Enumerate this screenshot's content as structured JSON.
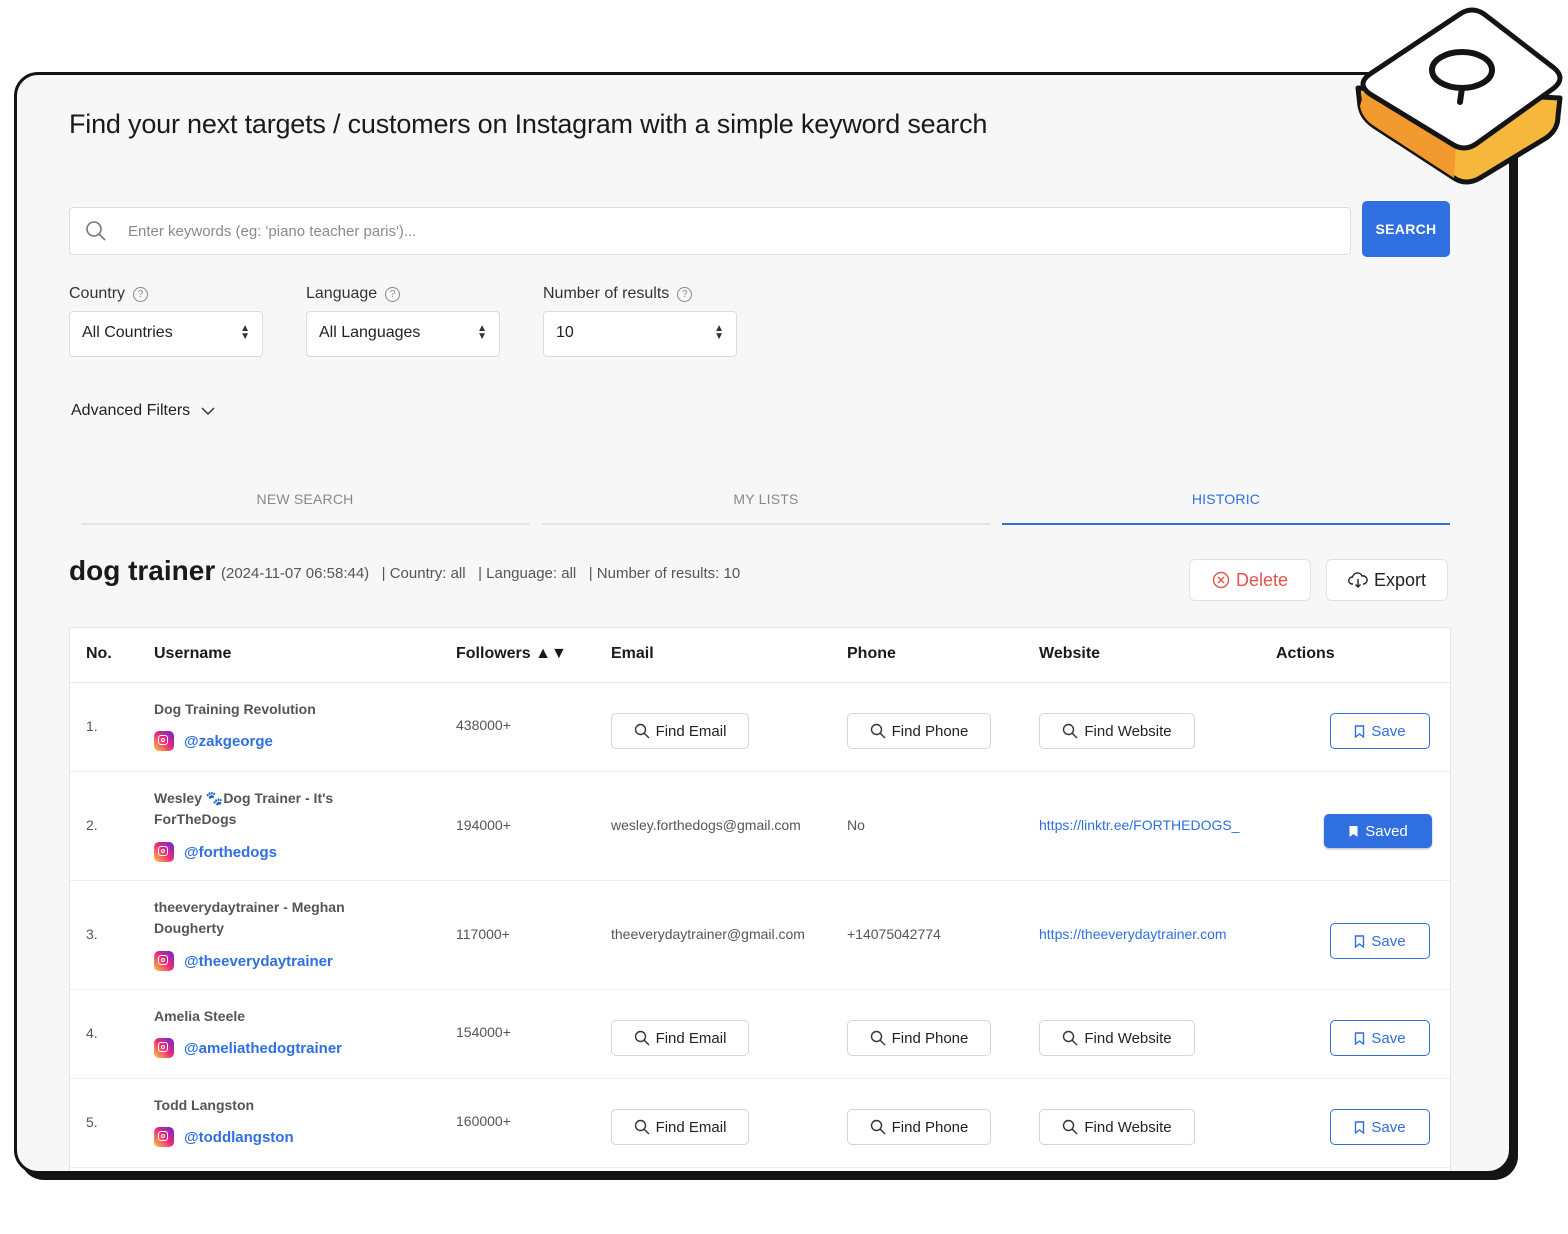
{
  "header": {
    "title": "Find your next targets / customers on Instagram with a simple keyword search"
  },
  "search": {
    "placeholder": "Enter keywords (eg: 'piano teacher paris')...",
    "button_label": "SEARCH"
  },
  "filters": {
    "country": {
      "label": "Country",
      "value": "All Countries"
    },
    "language": {
      "label": "Language",
      "value": "All Languages"
    },
    "results": {
      "label": "Number of results",
      "value": "10"
    },
    "advanced_label": "Advanced Filters"
  },
  "tabs": [
    {
      "label": "NEW SEARCH",
      "active": false
    },
    {
      "label": "MY LISTS",
      "active": false
    },
    {
      "label": "HISTORIC",
      "active": true
    }
  ],
  "historic": {
    "query": "dog trainer",
    "meta": "(2024-11-07 06:58:44)   | Country: all   | Language: all   | Number of results: 10",
    "delete_label": "Delete",
    "export_label": "Export"
  },
  "table": {
    "headers": {
      "no": "No.",
      "username": "Username",
      "followers": "Followers ▲▼",
      "email": "Email",
      "phone": "Phone",
      "website": "Website",
      "actions": "Actions"
    },
    "find_email": "Find Email",
    "find_phone": "Find Phone",
    "find_website": "Find Website",
    "save": "Save",
    "saved": "Saved",
    "rows": [
      {
        "no": "1.",
        "name": "Dog Training Revolution",
        "handle": "@zakgeorge",
        "followers": "438000+",
        "email": "",
        "phone": "",
        "website": "",
        "saved": false
      },
      {
        "no": "2.",
        "name": "Wesley 🐾Dog Trainer - It's ForTheDogs",
        "handle": "@forthedogs",
        "followers": "194000+",
        "email": "wesley.forthedogs@gmail.com",
        "phone": "No",
        "website": "https://linktr.ee/FORTHEDOGS_",
        "saved": true
      },
      {
        "no": "3.",
        "name": "theeverydaytrainer - Meghan Dougherty",
        "handle": "@theeverydaytrainer",
        "followers": "117000+",
        "email": "theeverydaytrainer@gmail.com",
        "phone": "+14075042774",
        "website": "https://theeverydaytrainer.com",
        "saved": false
      },
      {
        "no": "4.",
        "name": "Amelia Steele",
        "handle": "@ameliathedogtrainer",
        "followers": "154000+",
        "email": "",
        "phone": "",
        "website": "",
        "saved": false
      },
      {
        "no": "5.",
        "name": "Todd Langston",
        "handle": "@toddlangston",
        "followers": "160000+",
        "email": "",
        "phone": "",
        "website": "",
        "saved": false
      }
    ]
  },
  "icons": [
    "search-icon",
    "help-icon",
    "chevron-down-icon",
    "delete-icon",
    "cloud-download-icon",
    "instagram-icon",
    "bookmark-icon",
    "select-arrows-icon"
  ],
  "colors": {
    "accent": "#2f6fe0",
    "danger": "#e5534b",
    "badge_yellow": "#f5b83d"
  }
}
